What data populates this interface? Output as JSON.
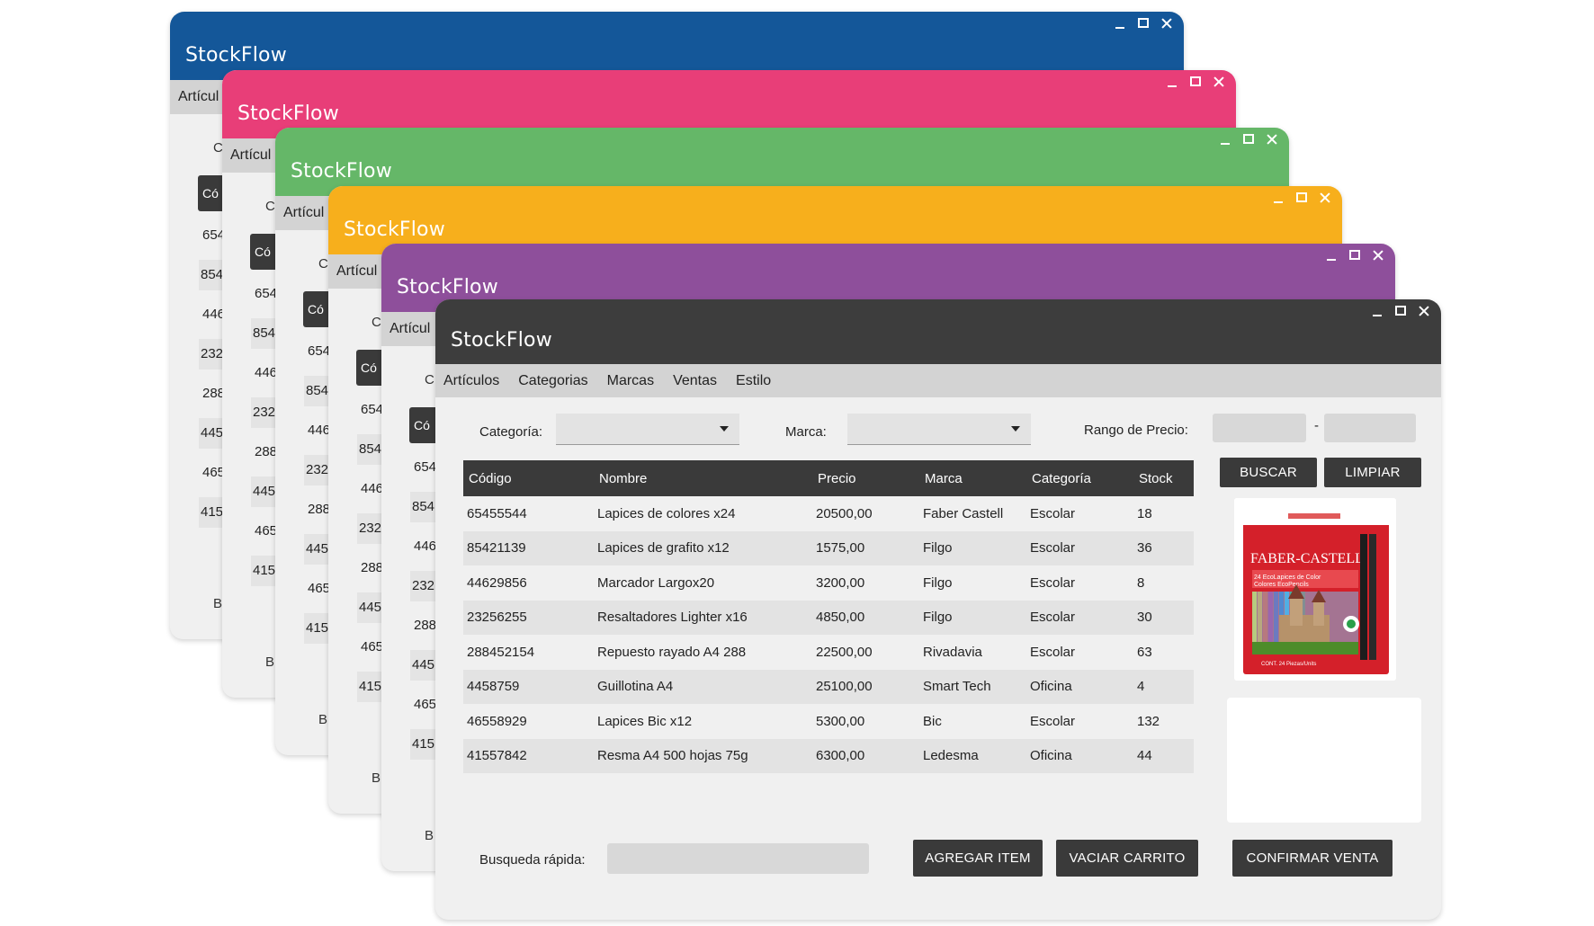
{
  "app": {
    "title": "StockFlow"
  },
  "colors": {
    "blue": "#145799",
    "pink": "#e83e78",
    "green": "#65b768",
    "orange": "#f7af1c",
    "purple": "#8e4f9b",
    "dark": "#3d3d3d"
  },
  "window_controls": {
    "minimize": "minimize-icon",
    "maximize": "maximize-icon",
    "close": "close-icon"
  },
  "menu": [
    "Artículos",
    "Categorias",
    "Marcas",
    "Ventas",
    "Estilo"
  ],
  "peek": {
    "menu_fragment": "Artícul",
    "filter_fragment": "C",
    "header_fragment": "Có",
    "codes": [
      "654",
      "854",
      "446",
      "232",
      "288",
      "445",
      "465",
      "415"
    ],
    "quick_fragment": "B"
  },
  "filters": {
    "category_label": "Categoría:",
    "brand_label": "Marca:",
    "price_range_label": "Rango de Precio:",
    "price_separator": "-",
    "category_value": "",
    "brand_value": "",
    "price_min": "",
    "price_max": ""
  },
  "buttons": {
    "search": "BUSCAR",
    "clear": "LIMPIAR",
    "add_item": "AGREGAR ITEM",
    "empty_cart": "VACIAR CARRITO",
    "confirm_sale": "CONFIRMAR VENTA"
  },
  "table": {
    "columns": [
      "Código",
      "Nombre",
      "Precio",
      "Marca",
      "Categoría",
      "Stock"
    ],
    "rows": [
      [
        "65455544",
        "Lapices de colores x24",
        "20500,00",
        "Faber Castell",
        "Escolar",
        "18"
      ],
      [
        "85421139",
        "Lapices de grafito x12",
        "1575,00",
        "Filgo",
        "Escolar",
        "36"
      ],
      [
        "44629856",
        "Marcador Largox20",
        "3200,00",
        "Filgo",
        "Escolar",
        "8"
      ],
      [
        "23256255",
        "Resaltadores Lighter x16",
        "4850,00",
        "Filgo",
        "Escolar",
        "30"
      ],
      [
        "288452154",
        "Repuesto rayado A4 288",
        "22500,00",
        "Rivadavia",
        "Escolar",
        "63"
      ],
      [
        "4458759",
        "Guillotina A4",
        "25100,00",
        "Smart Tech",
        "Oficina",
        "4"
      ],
      [
        "46558929",
        "Lapices Bic x12",
        "5300,00",
        "Bic",
        "Escolar",
        "132"
      ],
      [
        "41557842",
        "Resma A4 500 hojas 75g",
        "6300,00",
        "Ledesma",
        "Oficina",
        "44"
      ]
    ]
  },
  "product_image": {
    "brand": "FABER-CASTELL",
    "line1": "24 EcoLapices de Color",
    "line2": "Colores EcoPencils",
    "footer": "CONT. 24 Piezas/Units"
  },
  "quick_search": {
    "label": "Busqueda rápida:",
    "value": ""
  }
}
